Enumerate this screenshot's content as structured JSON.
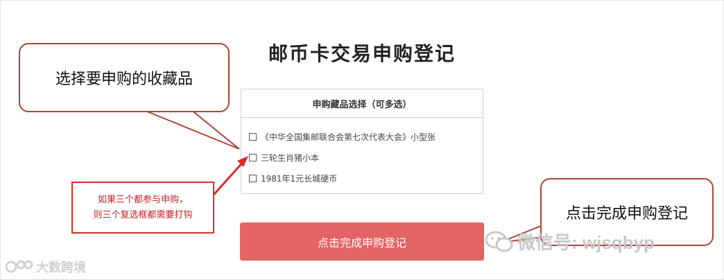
{
  "title": "邮币卡交易申购登记",
  "panel": {
    "header": "申购藏品选择（可多选）",
    "options": [
      {
        "label": "《中华全国集邮联合会第七次代表大会》小型张",
        "checked": false
      },
      {
        "label": "三轮生肖猪小本",
        "checked": false
      },
      {
        "label": "1981年1元长城硬币",
        "checked": false
      }
    ]
  },
  "submit_label": "点击完成申购登记",
  "annotations": {
    "left_bubble": "选择要申购的收藏品",
    "right_bubble": "点击完成申购登记",
    "note_line1": "如果三个都参与申购，",
    "note_line2": "则三个复选框都需要打钩"
  },
  "watermarks": {
    "wechat": "微信号: wjsqbyp",
    "logo": "大数跨境"
  },
  "colors": {
    "button": "#e36464",
    "bubble_border": "#a64638",
    "note_red": "#d52d2d"
  }
}
